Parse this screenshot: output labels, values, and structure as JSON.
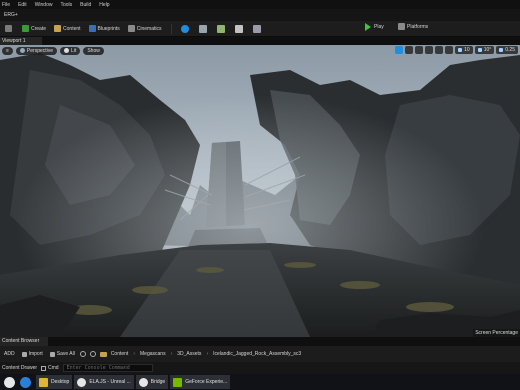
{
  "menu": {
    "items": [
      "File",
      "Edit",
      "Window",
      "Tools",
      "Build",
      "Help"
    ]
  },
  "project_tab": "ERG+",
  "toolbar": {
    "create_label": "Create",
    "content_label": "Content",
    "blueprints_label": "Blueprints",
    "cinematics_label": "Cinematics",
    "play_label": "Play",
    "platforms_label": "Platforms",
    "mode_icons": [
      "select-mode-icon",
      "landscape-mode-icon",
      "foliage-mode-icon",
      "mesh-paint-mode-icon",
      "modeling-mode-icon"
    ]
  },
  "viewport": {
    "tab_label": "Viewport 1",
    "perspective_label": "Perspective",
    "lit_label": "Lit",
    "show_label": "Show",
    "grid_snap_value": "10",
    "rotation_snap_value": "10°",
    "scale_snap_value": "0.25",
    "screen_percentage_label": "Screen Percentage"
  },
  "content_browser": {
    "tab_label": "Content Browser",
    "add_label": "ADD",
    "import_label": "Import",
    "save_all_label": "Save All",
    "breadcrumbs": [
      "Content",
      "Megascans",
      "3D_Assets",
      "Icelandic_Jagged_Rock_Assembly_sc3"
    ]
  },
  "status_bar": {
    "content_drawer_label": "Content Drawer",
    "cmd_label": "Cmd",
    "console_placeholder": "Enter Console Command"
  },
  "taskbar": {
    "items": [
      {
        "label": "Desktop"
      },
      {
        "label": "ELA.JS - Unreal ..."
      },
      {
        "label": "Bridge"
      },
      {
        "label": "GeForce Experie..."
      }
    ]
  },
  "colors": {
    "accent_blue": "#1e8fe0",
    "play_green": "#3ec53e",
    "folder_yellow": "#c7a351"
  }
}
